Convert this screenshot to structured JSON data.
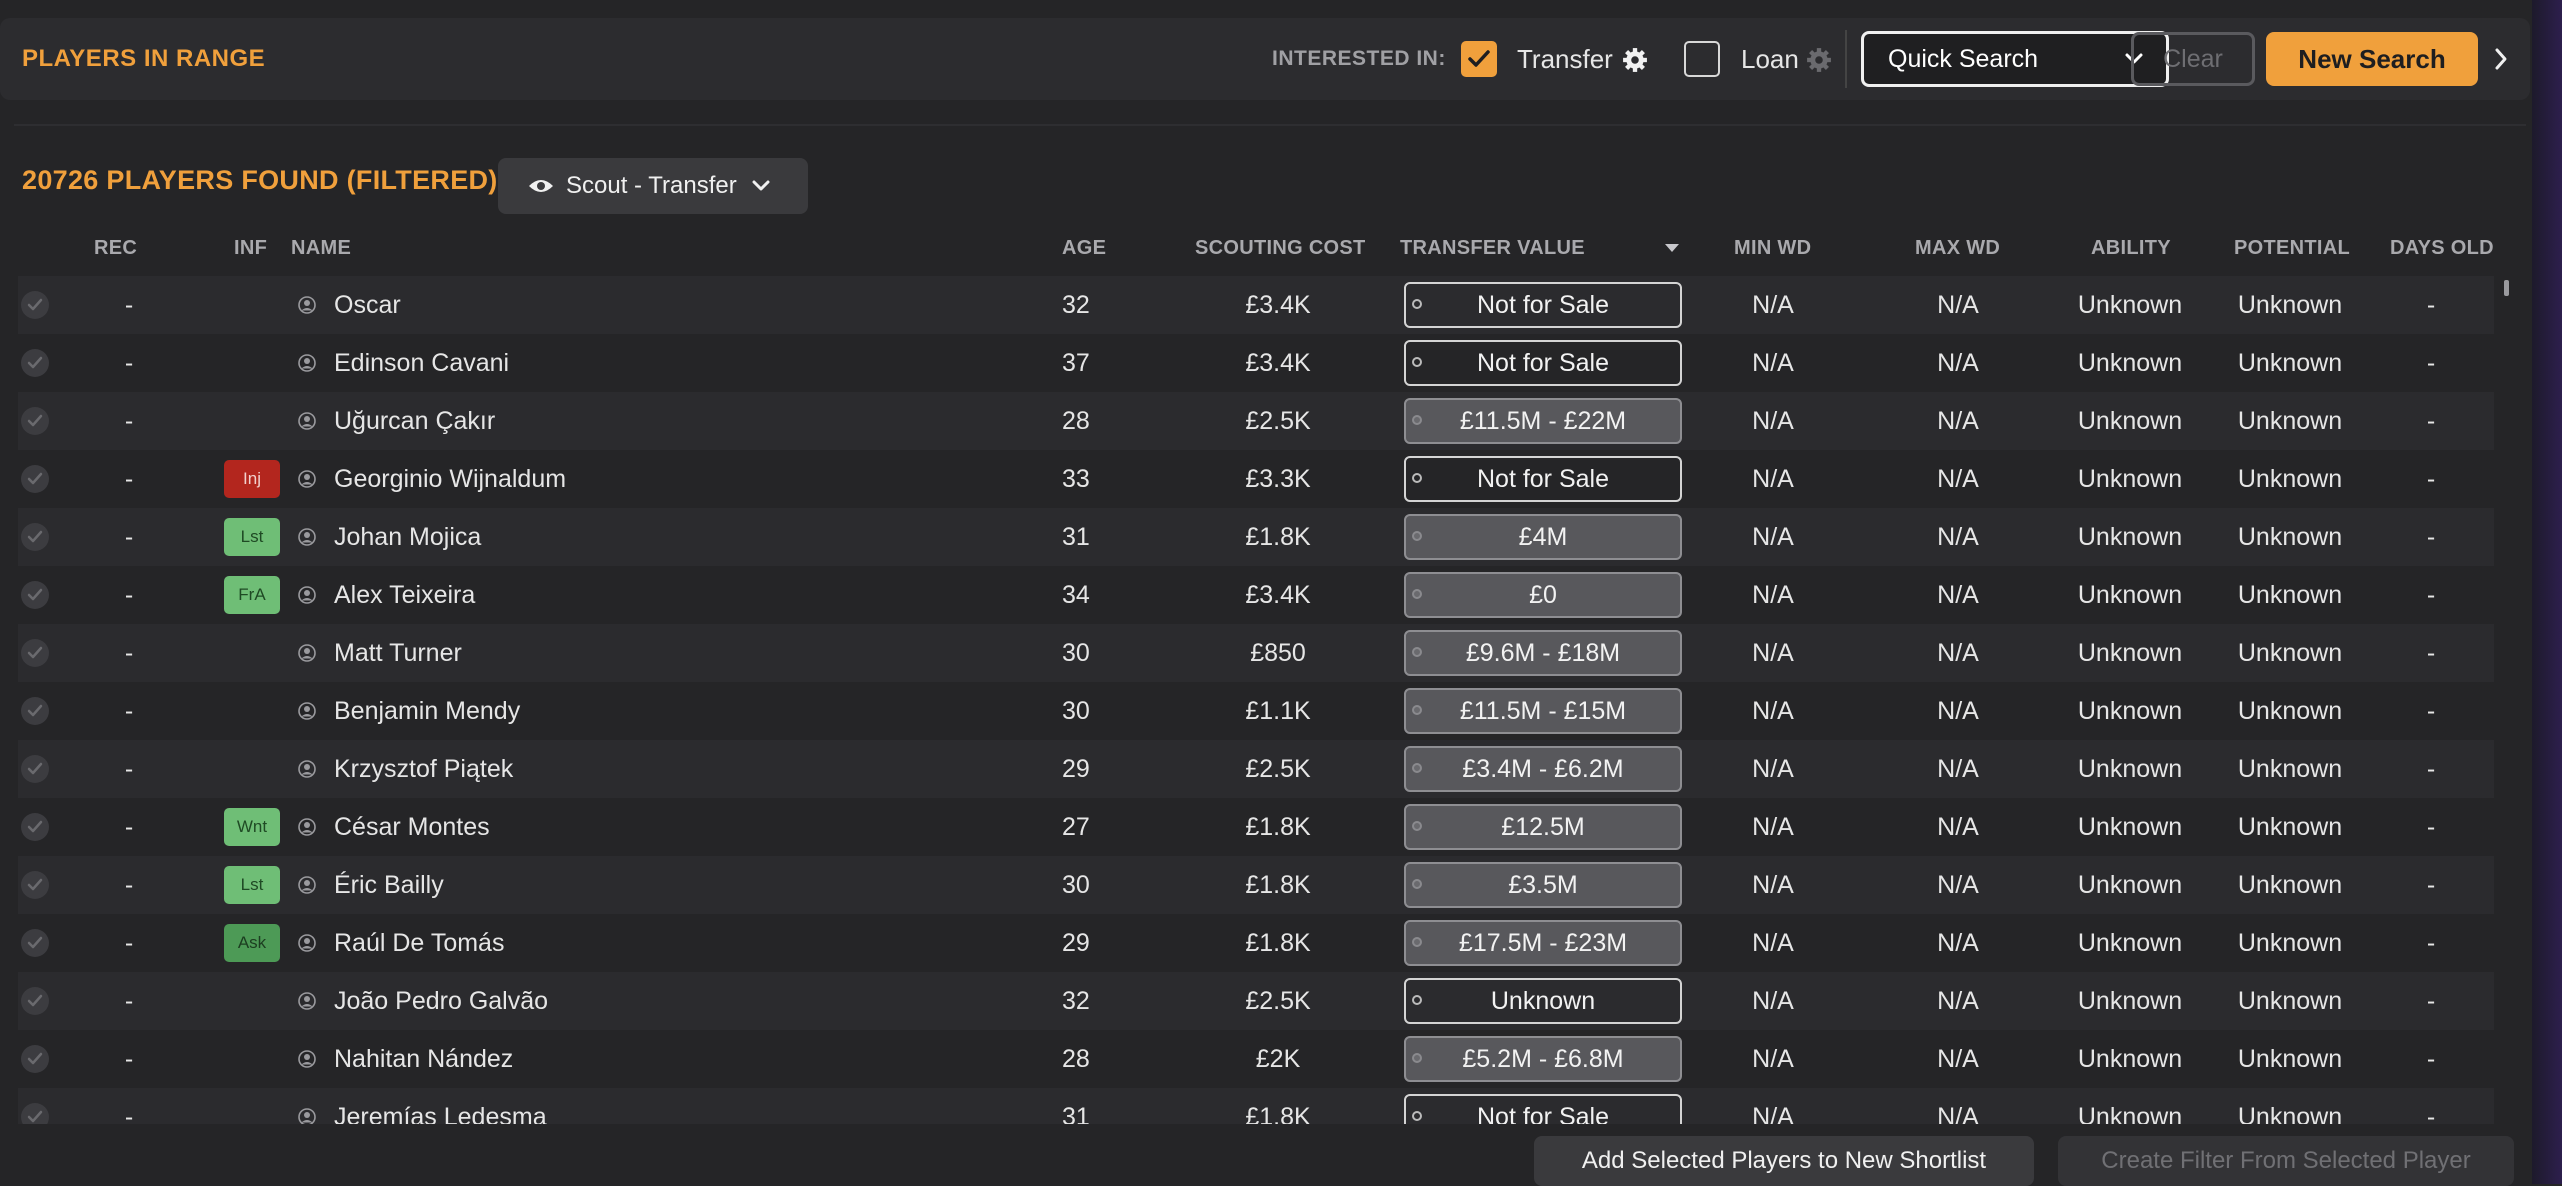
{
  "header": {
    "title": "PLAYERS IN RANGE",
    "interested_label": "INTERESTED IN:",
    "transfer_label": "Transfer",
    "transfer_checked": true,
    "loan_label": "Loan",
    "loan_checked": false,
    "quick_search_label": "Quick Search",
    "clear_label": "Clear",
    "new_search_label": "New Search"
  },
  "results": {
    "count_label": "20726 PLAYERS FOUND (FILTERED)",
    "view_label": "Scout - Transfer"
  },
  "columns": {
    "rec": "REC",
    "inf": "INF",
    "name": "NAME",
    "age": "AGE",
    "scouting_cost": "SCOUTING COST",
    "transfer_value": "TRANSFER VALUE",
    "min_wd": "MIN WD",
    "max_wd": "MAX WD",
    "ability": "ABILITY",
    "potential": "POTENTIAL",
    "days_old": "DAYS OLD"
  },
  "players": [
    {
      "rec": "-",
      "inf": "",
      "inf_color": "",
      "name": "Oscar",
      "age": "32",
      "cost": "£3.4K",
      "value": "Not for Sale",
      "value_style": "open",
      "min_wd": "N/A",
      "max_wd": "N/A",
      "ability": "Unknown",
      "potential": "Unknown",
      "days_old": "-"
    },
    {
      "rec": "-",
      "inf": "",
      "inf_color": "",
      "name": "Edinson Cavani",
      "age": "37",
      "cost": "£3.4K",
      "value": "Not for Sale",
      "value_style": "open",
      "min_wd": "N/A",
      "max_wd": "N/A",
      "ability": "Unknown",
      "potential": "Unknown",
      "days_old": "-"
    },
    {
      "rec": "-",
      "inf": "",
      "inf_color": "",
      "name": "Uğurcan Çakır",
      "age": "28",
      "cost": "£2.5K",
      "value": "£11.5M - £22M",
      "value_style": "filled",
      "min_wd": "N/A",
      "max_wd": "N/A",
      "ability": "Unknown",
      "potential": "Unknown",
      "days_old": "-"
    },
    {
      "rec": "-",
      "inf": "Inj",
      "inf_color": "red",
      "name": "Georginio Wijnaldum",
      "age": "33",
      "cost": "£3.3K",
      "value": "Not for Sale",
      "value_style": "open",
      "min_wd": "N/A",
      "max_wd": "N/A",
      "ability": "Unknown",
      "potential": "Unknown",
      "days_old": "-"
    },
    {
      "rec": "-",
      "inf": "Lst",
      "inf_color": "green",
      "name": "Johan Mojica",
      "age": "31",
      "cost": "£1.8K",
      "value": "£4M",
      "value_style": "filled",
      "min_wd": "N/A",
      "max_wd": "N/A",
      "ability": "Unknown",
      "potential": "Unknown",
      "days_old": "-"
    },
    {
      "rec": "-",
      "inf": "FrA",
      "inf_color": "green",
      "name": "Alex Teixeira",
      "age": "34",
      "cost": "£3.4K",
      "value": "£0",
      "value_style": "filled",
      "min_wd": "N/A",
      "max_wd": "N/A",
      "ability": "Unknown",
      "potential": "Unknown",
      "days_old": "-"
    },
    {
      "rec": "-",
      "inf": "",
      "inf_color": "",
      "name": "Matt Turner",
      "age": "30",
      "cost": "£850",
      "value": "£9.6M - £18M",
      "value_style": "filled",
      "min_wd": "N/A",
      "max_wd": "N/A",
      "ability": "Unknown",
      "potential": "Unknown",
      "days_old": "-"
    },
    {
      "rec": "-",
      "inf": "",
      "inf_color": "",
      "name": "Benjamin Mendy",
      "age": "30",
      "cost": "£1.1K",
      "value": "£11.5M - £15M",
      "value_style": "filled",
      "min_wd": "N/A",
      "max_wd": "N/A",
      "ability": "Unknown",
      "potential": "Unknown",
      "days_old": "-"
    },
    {
      "rec": "-",
      "inf": "",
      "inf_color": "",
      "name": "Krzysztof Piątek",
      "age": "29",
      "cost": "£2.5K",
      "value": "£3.4M - £6.2M",
      "value_style": "filled",
      "min_wd": "N/A",
      "max_wd": "N/A",
      "ability": "Unknown",
      "potential": "Unknown",
      "days_old": "-"
    },
    {
      "rec": "-",
      "inf": "Wnt",
      "inf_color": "green",
      "name": "César Montes",
      "age": "27",
      "cost": "£1.8K",
      "value": "£12.5M",
      "value_style": "filled",
      "min_wd": "N/A",
      "max_wd": "N/A",
      "ability": "Unknown",
      "potential": "Unknown",
      "days_old": "-"
    },
    {
      "rec": "-",
      "inf": "Lst",
      "inf_color": "green",
      "name": "Éric Bailly",
      "age": "30",
      "cost": "£1.8K",
      "value": "£3.5M",
      "value_style": "filled",
      "min_wd": "N/A",
      "max_wd": "N/A",
      "ability": "Unknown",
      "potential": "Unknown",
      "days_old": "-"
    },
    {
      "rec": "-",
      "inf": "Ask",
      "inf_color": "dkgreen",
      "name": "Raúl De Tomás",
      "age": "29",
      "cost": "£1.8K",
      "value": "£17.5M - £23M",
      "value_style": "filled",
      "min_wd": "N/A",
      "max_wd": "N/A",
      "ability": "Unknown",
      "potential": "Unknown",
      "days_old": "-"
    },
    {
      "rec": "-",
      "inf": "",
      "inf_color": "",
      "name": "João Pedro Galvão",
      "age": "32",
      "cost": "£2.5K",
      "value": "Unknown",
      "value_style": "open",
      "min_wd": "N/A",
      "max_wd": "N/A",
      "ability": "Unknown",
      "potential": "Unknown",
      "days_old": "-"
    },
    {
      "rec": "-",
      "inf": "",
      "inf_color": "",
      "name": "Nahitan Nández",
      "age": "28",
      "cost": "£2K",
      "value": "£5.2M - £6.8M",
      "value_style": "filled",
      "min_wd": "N/A",
      "max_wd": "N/A",
      "ability": "Unknown",
      "potential": "Unknown",
      "days_old": "-"
    },
    {
      "rec": "-",
      "inf": "",
      "inf_color": "",
      "name": "Jeremías Ledesma",
      "age": "31",
      "cost": "£1.8K",
      "value": "Not for Sale",
      "value_style": "open",
      "min_wd": "N/A",
      "max_wd": "N/A",
      "ability": "Unknown",
      "potential": "Unknown",
      "days_old": "-"
    }
  ],
  "footer": {
    "add_shortlist_label": "Add Selected Players to New Shortlist",
    "create_filter_label": "Create Filter From Selected Player"
  },
  "colors": {
    "accent": "#f0a03c",
    "background": "#252527"
  }
}
